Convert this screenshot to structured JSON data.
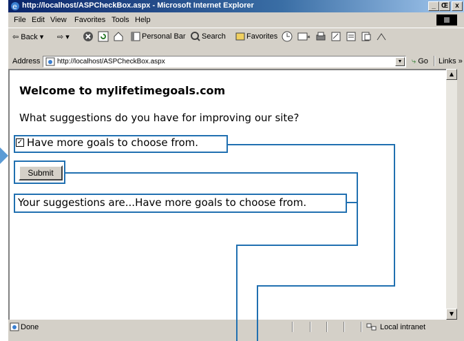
{
  "window": {
    "title": "http://localhost/ASPCheckBox.aspx - Microsoft Internet Explorer",
    "controls": [
      "_",
      "Œ",
      "x"
    ]
  },
  "menu": [
    "File",
    "Edit",
    "View",
    "Favorites",
    "Tools",
    "Help"
  ],
  "toolbar": {
    "back": "⇦ Back ▾",
    "forward": "⇨ ▾",
    "personal_bar": "Personal Bar",
    "search": "Search",
    "favorites": "Favorites"
  },
  "address": {
    "label": "Address",
    "url": "http://localhost/ASPCheckBox.aspx",
    "go": "Go",
    "links": "Links »"
  },
  "page": {
    "heading": "Welcome to mylifetimegoals.com",
    "question": "What suggestions do you have for improving our site?",
    "checkbox_label": "Have more goals to choose from.",
    "checkbox_checked": true,
    "submit_label": "Submit",
    "result": "Your suggestions are...Have more goals to choose from."
  },
  "status": {
    "text": "Done",
    "zone": "Local intranet"
  },
  "colors": {
    "callout": "#1f6fb0",
    "title_bar": "#0a246a"
  }
}
